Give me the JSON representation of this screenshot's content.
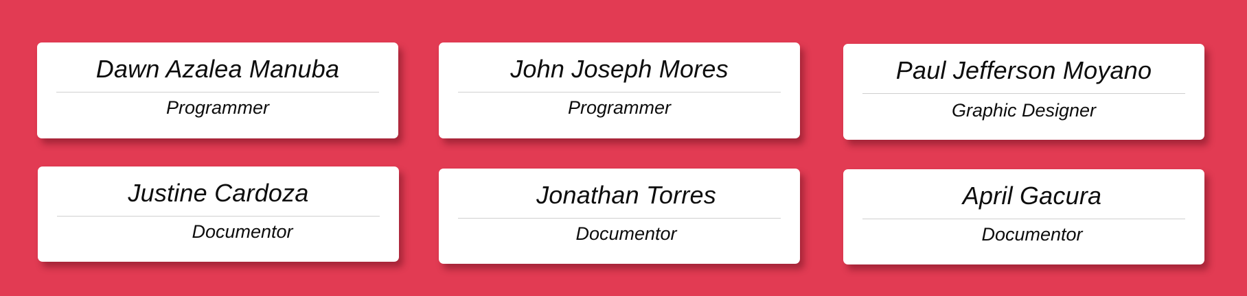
{
  "theme": {
    "background": "#e23b53",
    "card": "#ffffff",
    "text": "#0d0d0d"
  },
  "members": [
    {
      "name": "Dawn Azalea Manuba",
      "role": "Programmer"
    },
    {
      "name": "John Joseph Mores",
      "role": "Programmer"
    },
    {
      "name": "Paul Jefferson Moyano",
      "role": "Graphic Designer"
    },
    {
      "name": "Justine Cardoza",
      "role": "Documentor"
    },
    {
      "name": "Jonathan Torres",
      "role": "Documentor"
    },
    {
      "name": "April Gacura",
      "role": "Documentor"
    }
  ]
}
